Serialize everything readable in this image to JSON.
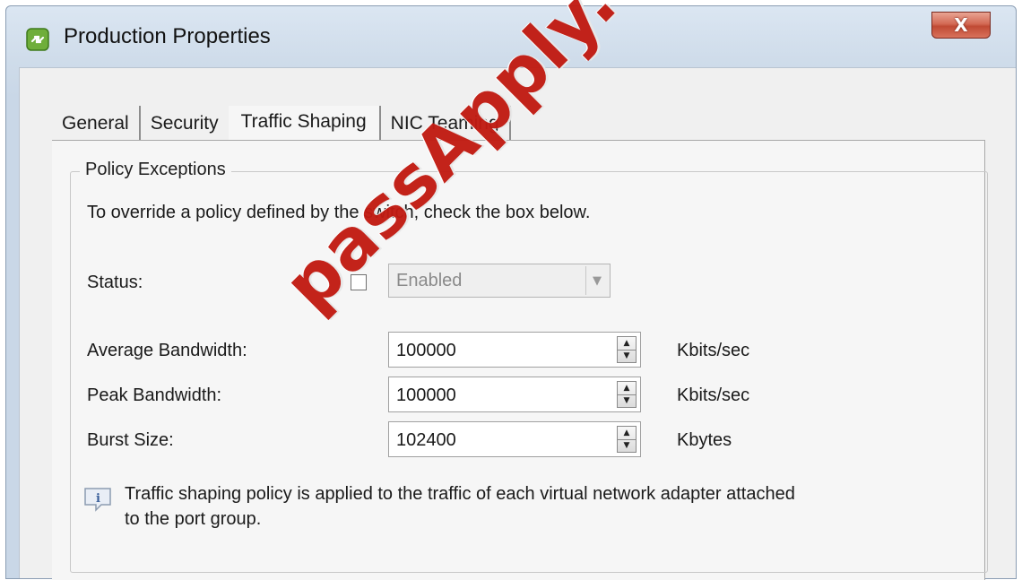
{
  "window": {
    "title": "Production Properties",
    "close_label": "X",
    "app_icon": "link-network-icon"
  },
  "tabs": [
    {
      "label": "General",
      "active": false
    },
    {
      "label": "Security",
      "active": false
    },
    {
      "label": "Traffic Shaping",
      "active": true
    },
    {
      "label": "NIC Teaming",
      "active": false
    }
  ],
  "policy": {
    "group_title": "Policy Exceptions",
    "instruction": "To override a policy defined by the switch, check the box below.",
    "status": {
      "label": "Status:",
      "checked": false,
      "value": "Enabled"
    },
    "average_bandwidth": {
      "label": "Average Bandwidth:",
      "value": "100000",
      "unit": "Kbits/sec"
    },
    "peak_bandwidth": {
      "label": "Peak Bandwidth:",
      "value": "100000",
      "unit": "Kbits/sec"
    },
    "burst_size": {
      "label": "Burst Size:",
      "value": "102400",
      "unit": "Kbytes"
    },
    "note_line1": "Traffic shaping policy is applied to the traffic of each virtual network adapter attached",
    "note_line2": "to the port group."
  },
  "watermark": "passApply.com",
  "colors": {
    "watermark": "#c11b12",
    "close_button": "#c9503a",
    "title_bar": "#d4e0ee"
  }
}
